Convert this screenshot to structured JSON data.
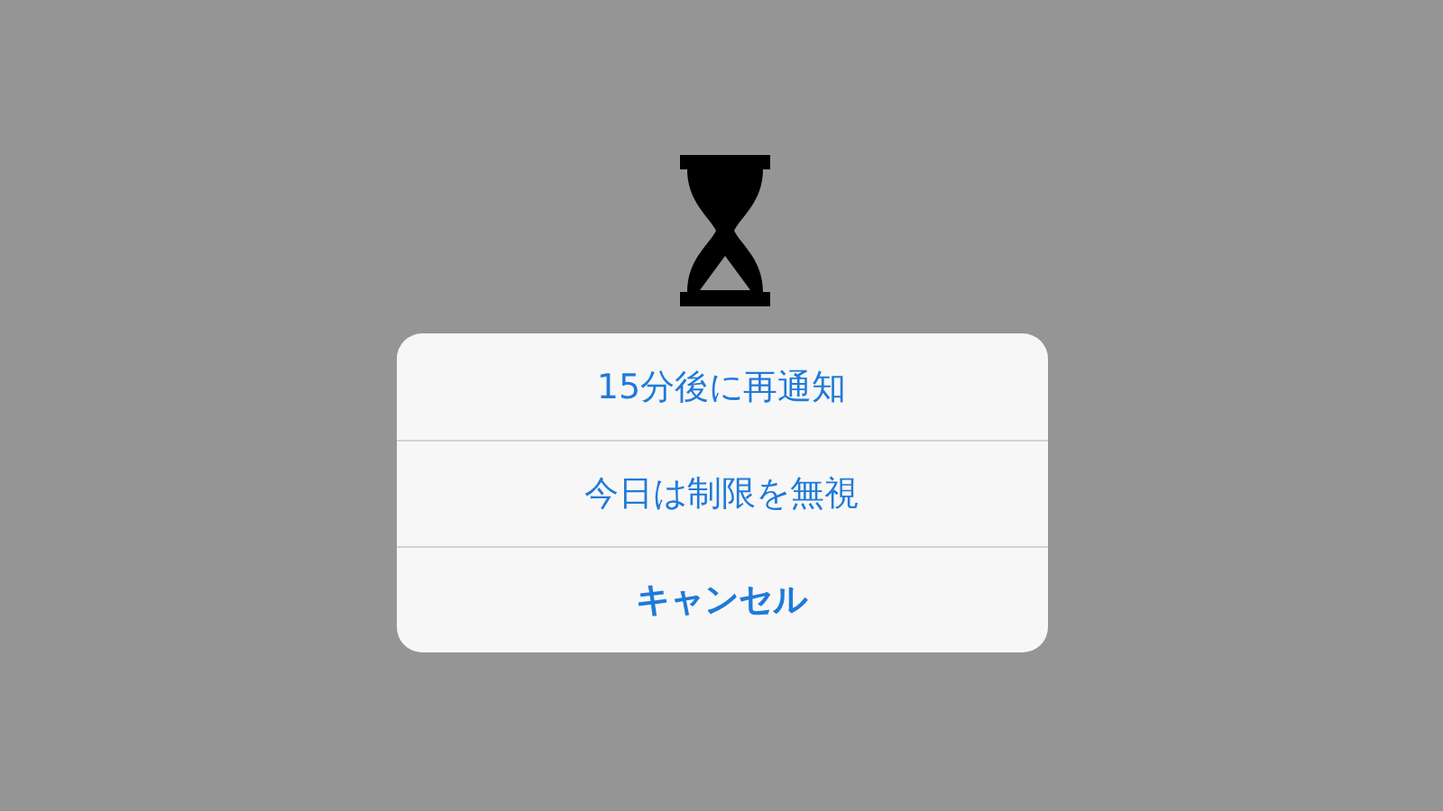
{
  "action_sheet": {
    "actions": [
      {
        "label": "15分後に再通知",
        "kind": "default"
      },
      {
        "label": "今日は制限を無視",
        "kind": "default"
      },
      {
        "label": "キャンセル",
        "kind": "cancel"
      }
    ]
  }
}
